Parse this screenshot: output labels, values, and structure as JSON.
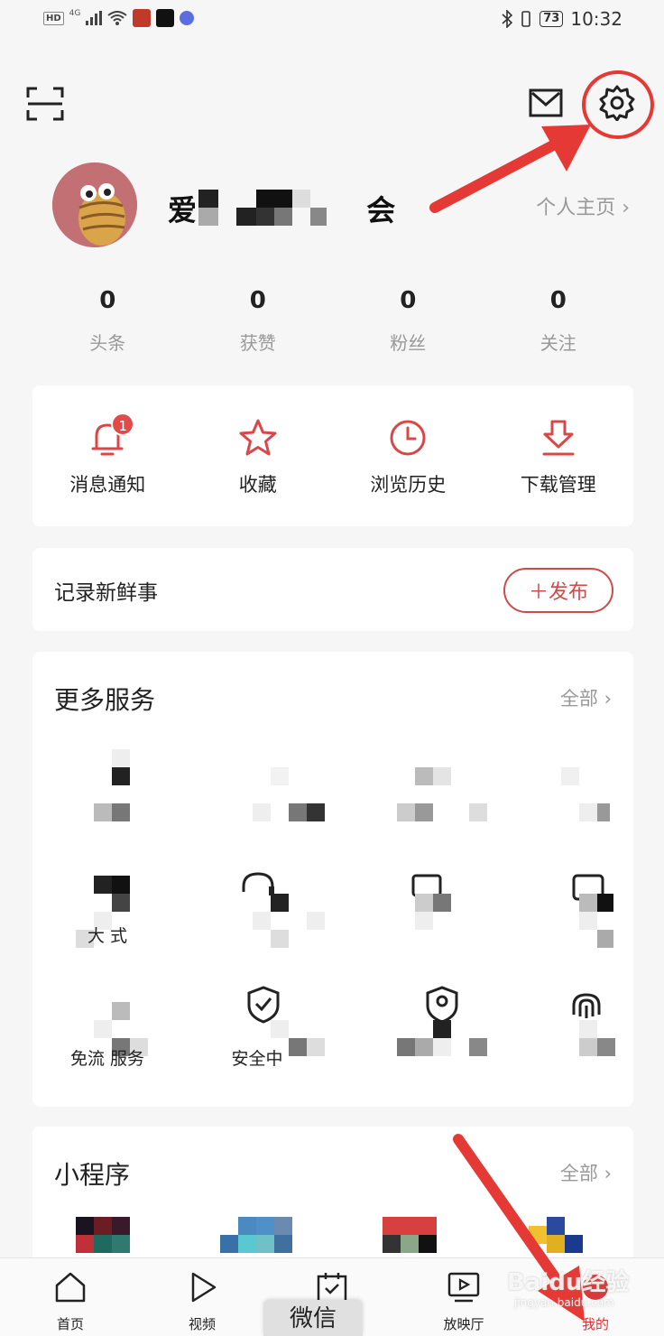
{
  "status_bar": {
    "left_text": "HD",
    "signal_text": "4G",
    "battery": "73",
    "time": "10:32"
  },
  "header": {
    "scan_icon": "scan-icon",
    "mail_icon": "mail-icon",
    "settings_icon": "gear-icon"
  },
  "profile": {
    "username_start": "爱",
    "username_end": "会",
    "homepage_link": "个人主页 ›"
  },
  "stats": [
    {
      "value": "0",
      "label": "头条"
    },
    {
      "value": "0",
      "label": "获赞"
    },
    {
      "value": "0",
      "label": "粉丝"
    },
    {
      "value": "0",
      "label": "关注"
    }
  ],
  "quick_actions": [
    {
      "label": "消息通知",
      "icon": "bell-icon",
      "badge": "1"
    },
    {
      "label": "收藏",
      "icon": "star-icon"
    },
    {
      "label": "浏览历史",
      "icon": "clock-icon"
    },
    {
      "label": "下载管理",
      "icon": "download-icon"
    }
  ],
  "post": {
    "title": "记录新鲜事",
    "button_label": "＋发布"
  },
  "services": {
    "title": "更多服务",
    "more": "全部 ›",
    "items": [
      {
        "label": ""
      },
      {
        "label": ""
      },
      {
        "label": ""
      },
      {
        "label": ""
      },
      {
        "label": "大 式"
      },
      {
        "label": ""
      },
      {
        "label": ""
      },
      {
        "label": ""
      },
      {
        "label": "免流 服务"
      },
      {
        "label": "安全中"
      },
      {
        "label": ""
      },
      {
        "label": ""
      }
    ]
  },
  "mini_programs": {
    "title": "小程序",
    "more": "全部 ›"
  },
  "tabbar": [
    {
      "label": "首页",
      "icon": "home-icon"
    },
    {
      "label": "视频",
      "icon": "play-icon"
    },
    {
      "label": "",
      "icon": "calendar-check-icon"
    },
    {
      "label": "放映厅",
      "icon": "tv-play-icon"
    },
    {
      "label": "我的",
      "icon": "profile-icon"
    }
  ],
  "overlay": {
    "wechat": "微信",
    "watermark": "Baidu经验",
    "watermark_sub": "jingyan.baidu.com"
  },
  "colors": {
    "accent": "#d84848",
    "annotation": "#e53935"
  }
}
